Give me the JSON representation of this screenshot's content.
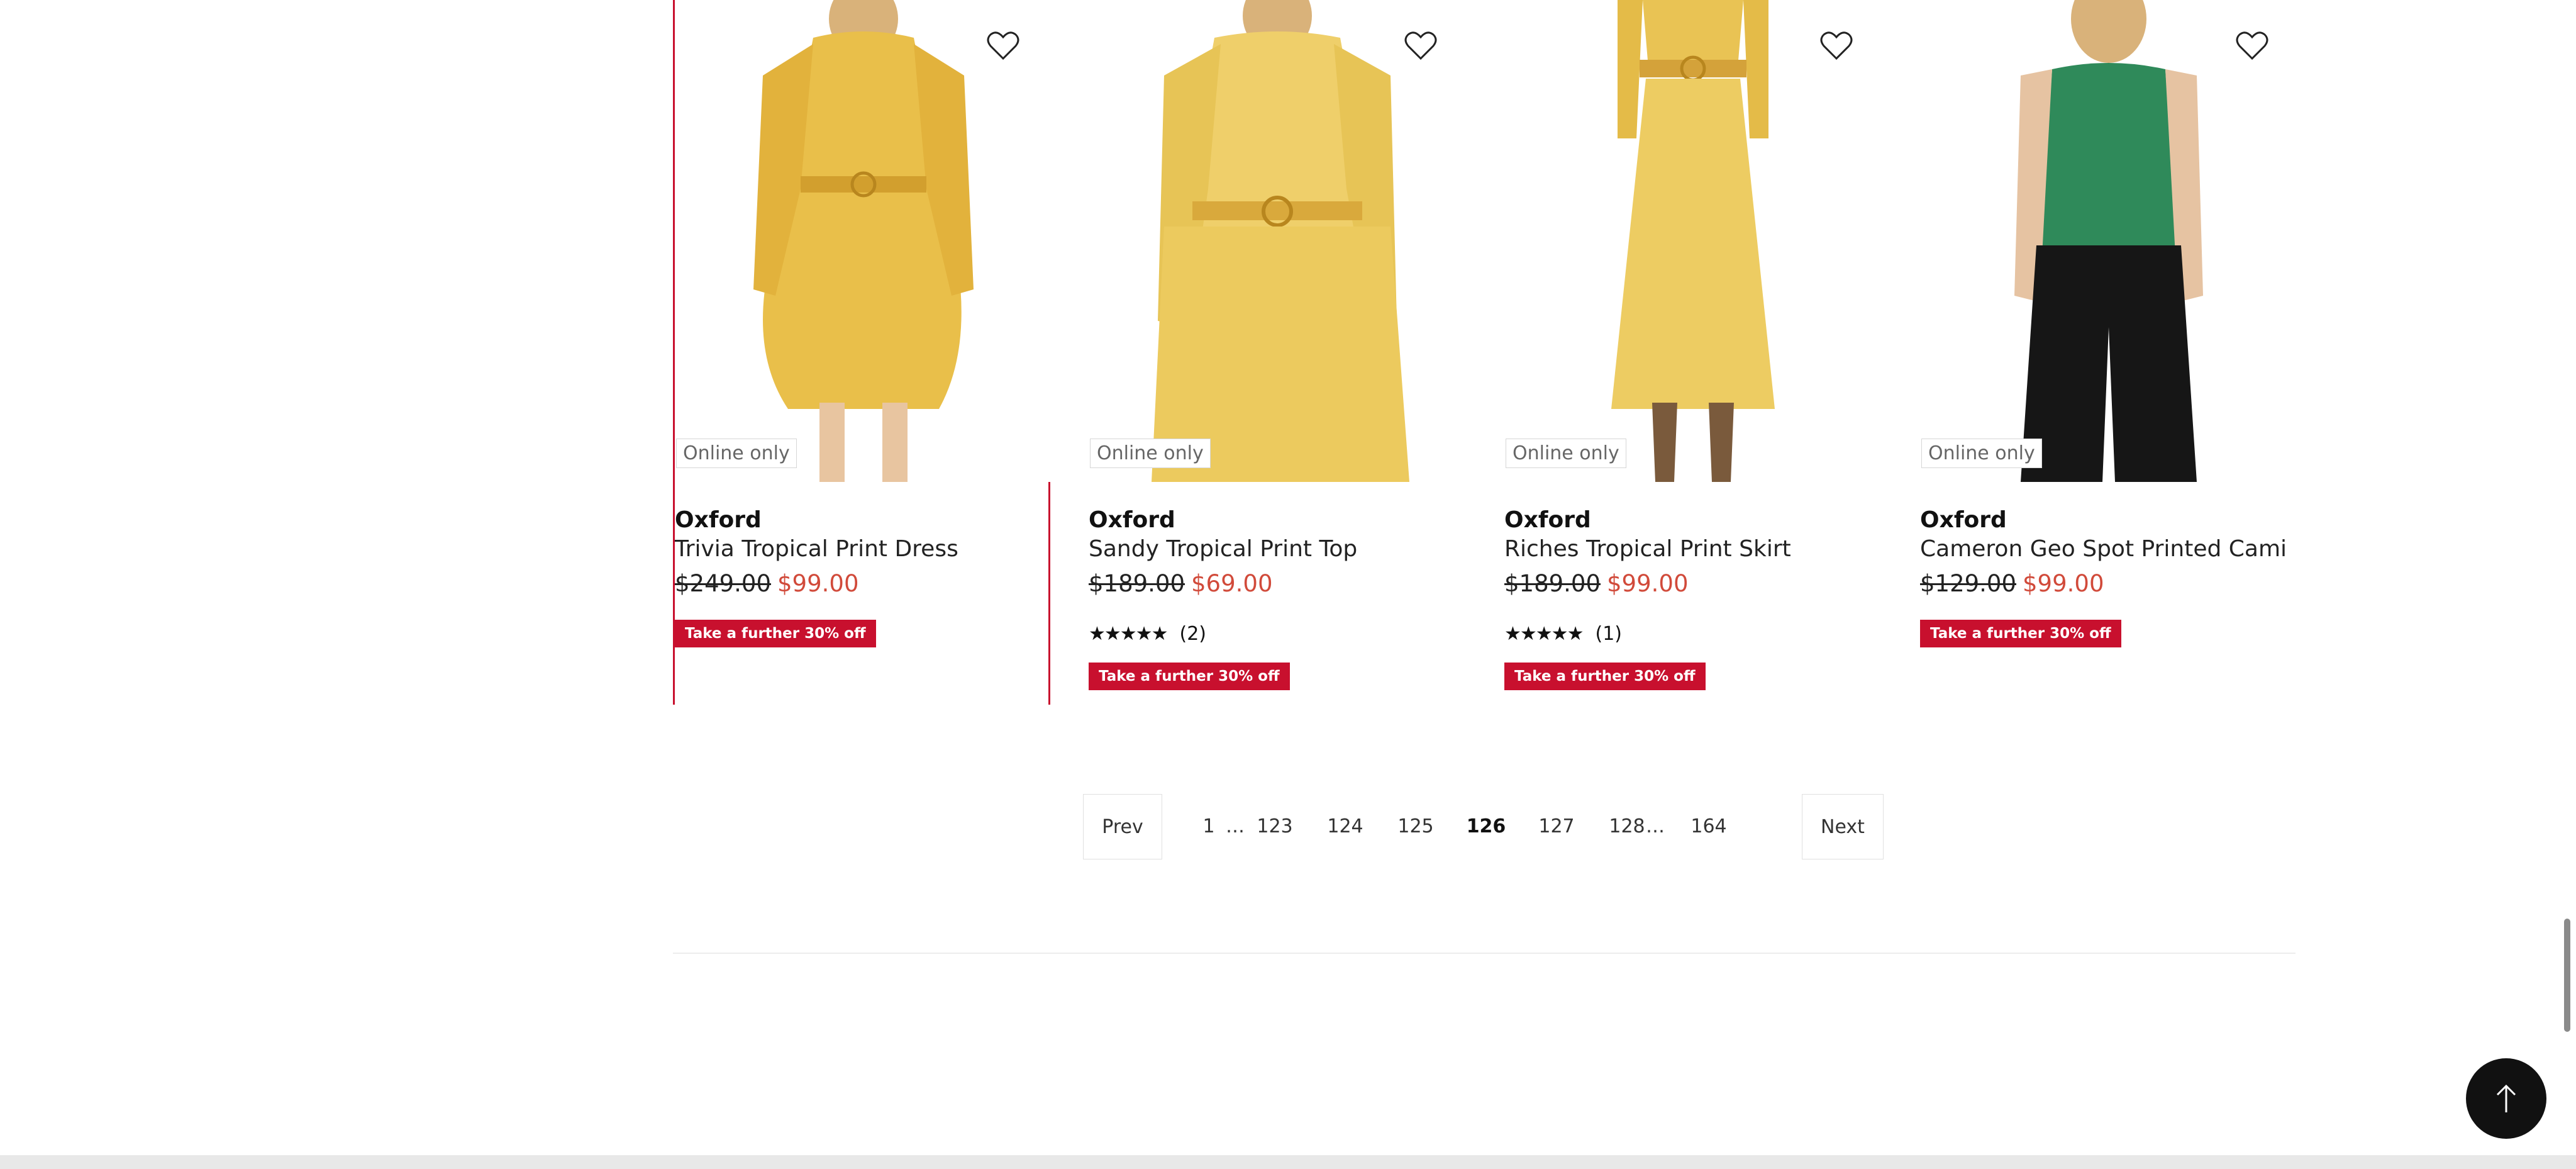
{
  "products": [
    {
      "badge_online": "Online only",
      "brand": "Oxford",
      "name": "Trivia Tropical Print Dress",
      "was": "$249.00",
      "now": "$99.00",
      "stars": "",
      "count": "",
      "promo": "Take a further 30% off",
      "garment": "dress-yellow"
    },
    {
      "badge_online": "Online only",
      "brand": "Oxford",
      "name": "Sandy Tropical Print Top",
      "was": "$189.00",
      "now": "$69.00",
      "stars": "★★★★★",
      "count": "(2)",
      "promo": "Take a further 30% off",
      "garment": "top-yellow"
    },
    {
      "badge_online": "Online only",
      "brand": "Oxford",
      "name": "Riches Tropical Print Skirt",
      "was": "$189.00",
      "now": "$99.00",
      "stars": "★★★★★",
      "count": "(1)",
      "promo": "Take a further 30% off",
      "garment": "skirt-yellow"
    },
    {
      "badge_online": "Online only",
      "brand": "Oxford",
      "name": "Cameron Geo Spot Printed Cami",
      "was": "$129.00",
      "now": "$99.00",
      "stars": "",
      "count": "",
      "promo": "Take a further 30% off",
      "garment": "cami-green"
    }
  ],
  "pagination": {
    "prev": "Prev",
    "next": "Next",
    "items": [
      "1",
      "…",
      "123",
      "124",
      "125",
      "126",
      "127",
      "128",
      "…",
      "164"
    ],
    "current": "126"
  },
  "colors": {
    "accent": "#c8102e",
    "sale": "#d14a3a"
  },
  "icons": {
    "wishlist": "heart-icon",
    "back_to_top": "arrow-up-icon"
  }
}
